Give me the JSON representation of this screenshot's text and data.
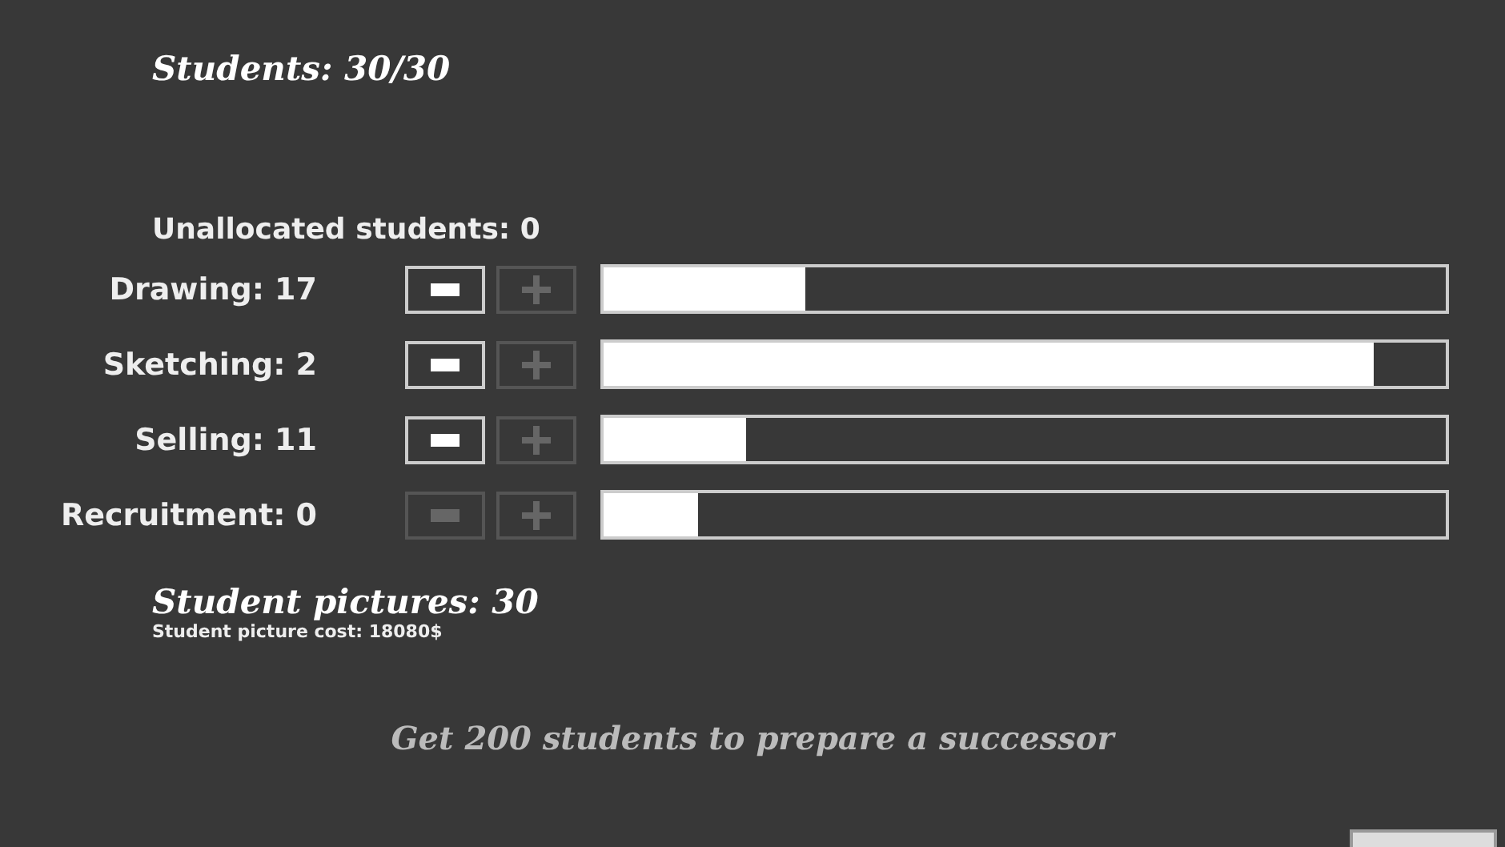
{
  "students": "Students: 30/30",
  "unallocated": "Unallocated students: 0",
  "rows": [
    {
      "label": "Drawing: 17",
      "minus_disabled": false,
      "plus_disabled": true,
      "level": 0.24
    },
    {
      "label": "Sketching: 2",
      "minus_disabled": false,
      "plus_disabled": true,
      "level": 0.915
    },
    {
      "label": "Selling: 11",
      "minus_disabled": false,
      "plus_disabled": true,
      "level": 0.17
    },
    {
      "label": "Recruitment: 0",
      "minus_disabled": true,
      "plus_disabled": true,
      "level": 0.113
    }
  ],
  "pictures": "Student pictures: 30",
  "picture_cost": "Student picture cost: 18080$",
  "goal": "Get 200 students to prepare a successor"
}
